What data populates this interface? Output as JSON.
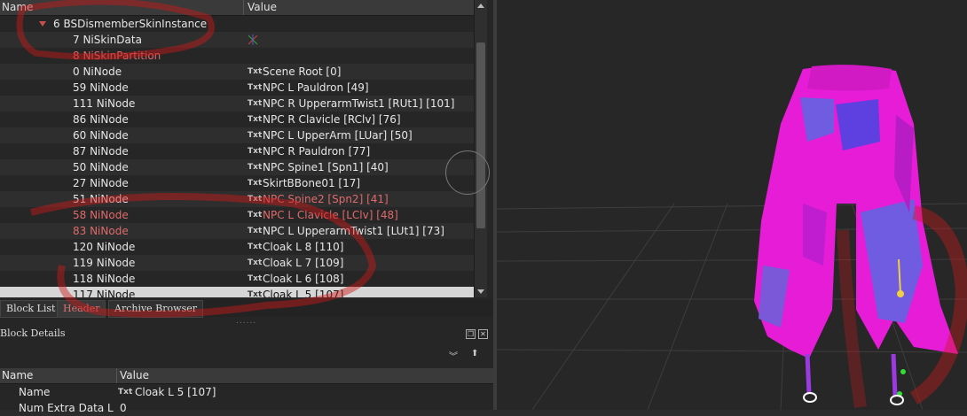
{
  "tree": {
    "col_name": "Name",
    "col_value": "Value",
    "root": {
      "label": "6 BSDismemberSkinInstance"
    },
    "rows": [
      {
        "name": "7 NiSkinData",
        "value": "",
        "icon": "axes-icon",
        "txt": false,
        "red_name": false,
        "red_value": false
      },
      {
        "name": "8 NiSkinPartition",
        "value": "",
        "icon": "",
        "txt": false,
        "red_name": true,
        "red_value": false
      },
      {
        "name": "0 NiNode",
        "value": "Scene Root [0]",
        "txt": true,
        "red_name": false,
        "red_value": false
      },
      {
        "name": "59 NiNode",
        "value": "NPC L Pauldron [49]",
        "txt": true,
        "red_name": false,
        "red_value": false
      },
      {
        "name": "111 NiNode",
        "value": "NPC R UpperarmTwist1 [RUt1] [101]",
        "txt": true,
        "red_name": false,
        "red_value": false
      },
      {
        "name": "86 NiNode",
        "value": "NPC R Clavicle [RClv] [76]",
        "txt": true,
        "red_name": false,
        "red_value": false
      },
      {
        "name": "60 NiNode",
        "value": "NPC L UpperArm [LUar] [50]",
        "txt": true,
        "red_name": false,
        "red_value": false
      },
      {
        "name": "87 NiNode",
        "value": "NPC R Pauldron [77]",
        "txt": true,
        "red_name": false,
        "red_value": false
      },
      {
        "name": "50 NiNode",
        "value": "NPC Spine1 [Spn1] [40]",
        "txt": true,
        "red_name": false,
        "red_value": false
      },
      {
        "name": "27 NiNode",
        "value": "SkirtBBone01 [17]",
        "txt": true,
        "red_name": false,
        "red_value": false
      },
      {
        "name": "51 NiNode",
        "value": "NPC Spine2 [Spn2] [41]",
        "txt": true,
        "red_name": false,
        "red_value": true
      },
      {
        "name": "58 NiNode",
        "value": "NPC L Clavicle [LClv] [48]",
        "txt": true,
        "red_name": true,
        "red_value": true
      },
      {
        "name": "83 NiNode",
        "value": "NPC L UpperarmTwist1 [LUt1] [73]",
        "txt": true,
        "red_name": true,
        "red_value": false
      },
      {
        "name": "120 NiNode",
        "value": "Cloak L 8 [110]",
        "txt": true,
        "red_name": false,
        "red_value": false
      },
      {
        "name": "119 NiNode",
        "value": "Cloak L 7 [109]",
        "txt": true,
        "red_name": false,
        "red_value": false
      },
      {
        "name": "118 NiNode",
        "value": "Cloak L 6 [108]",
        "txt": true,
        "red_name": false,
        "red_value": false
      },
      {
        "name": "117 NiNode",
        "value": "Cloak L 5 [107]",
        "txt": true,
        "red_name": false,
        "red_value": false,
        "selected": true
      }
    ]
  },
  "tabs": [
    {
      "label": "Block List",
      "active": false
    },
    {
      "label": "Header",
      "active": true
    },
    {
      "label": "Archive Browser",
      "active": false
    }
  ],
  "details": {
    "title": "Block Details",
    "col_name": "Name",
    "col_value": "Value",
    "rows": [
      {
        "k": "Name",
        "v": "Cloak L 5 [107]",
        "txt": true
      },
      {
        "k": "Num Extra Data L",
        "v": "0",
        "txt": false
      }
    ]
  },
  "icons": {
    "expander": "triangle-down-icon",
    "txt_badge": "Txt",
    "restore": "restore-icon",
    "close": "close-icon",
    "nav_down": "double-chevron-down-icon",
    "nav_up": "up-arrow-icon"
  },
  "colors": {
    "red_text": "#e06a6a",
    "mesh_magenta": "#e61cd6",
    "mesh_blue": "#6f5ce0",
    "annotation_red": "#d01818"
  }
}
